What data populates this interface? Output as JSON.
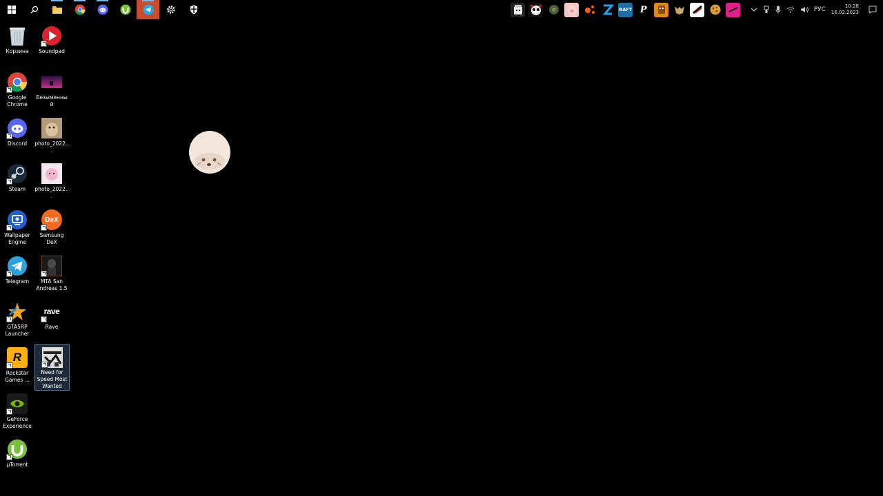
{
  "taskbar": {
    "apps": [
      {
        "name": "start-button",
        "icon": "windows-logo"
      },
      {
        "name": "search-button",
        "icon": "search-icon"
      },
      {
        "name": "file-explorer-button",
        "icon": "folder-icon"
      },
      {
        "name": "chrome-button",
        "icon": "chrome-icon"
      },
      {
        "name": "discord-button",
        "icon": "discord-icon"
      },
      {
        "name": "utorrent-button",
        "icon": "utorrent-icon"
      },
      {
        "name": "telegram-button",
        "icon": "telegram-icon",
        "active": true
      },
      {
        "name": "settings-button",
        "icon": "gear-icon"
      },
      {
        "name": "security-button",
        "icon": "shield-icon"
      }
    ],
    "tray": {
      "language": "РУС",
      "time": "10:28",
      "date": "16.02.2023"
    }
  },
  "desktop": {
    "icons": [
      {
        "label": "Корзина",
        "icon": "recycle-bin-icon"
      },
      {
        "label": "Soundpad",
        "icon": "soundpad-icon"
      },
      {
        "label": "Google Chrome",
        "icon": "chrome-icon"
      },
      {
        "label": "Безымянный",
        "icon": "image-file-icon"
      },
      {
        "label": "Discord",
        "icon": "discord-icon"
      },
      {
        "label": "photo_2022...",
        "icon": "photo-icon"
      },
      {
        "label": "Steam",
        "icon": "steam-icon"
      },
      {
        "label": "photo_2022...",
        "icon": "photo-icon"
      },
      {
        "label": "Wallpaper Engine",
        "icon": "wallpaper-engine-icon"
      },
      {
        "label": "Samsung DeX",
        "icon": "samsung-dex-icon",
        "text": "DeX"
      },
      {
        "label": "Telegram",
        "icon": "telegram-icon"
      },
      {
        "label": "MTA San Andreas 1.5",
        "icon": "mta-icon"
      },
      {
        "label": "GTA5RP Launcher",
        "icon": "gta5rp-icon"
      },
      {
        "label": "Rave",
        "icon": "rave-icon",
        "text": "rave"
      },
      {
        "label": "Rockstar Games ...",
        "icon": "rockstar-icon",
        "text": "R"
      },
      {
        "label": "Need for Speed Most Wanted",
        "icon": "nfs-icon",
        "selected": true
      },
      {
        "label": "GeForce Experience",
        "icon": "geforce-icon"
      },
      {
        "label": "µTorrent",
        "icon": "utorrent-icon"
      }
    ]
  },
  "colors": {
    "background": "#000000",
    "taskbar": "#000000",
    "active_accent": "#76b9ed",
    "selection": "#78aadc"
  }
}
